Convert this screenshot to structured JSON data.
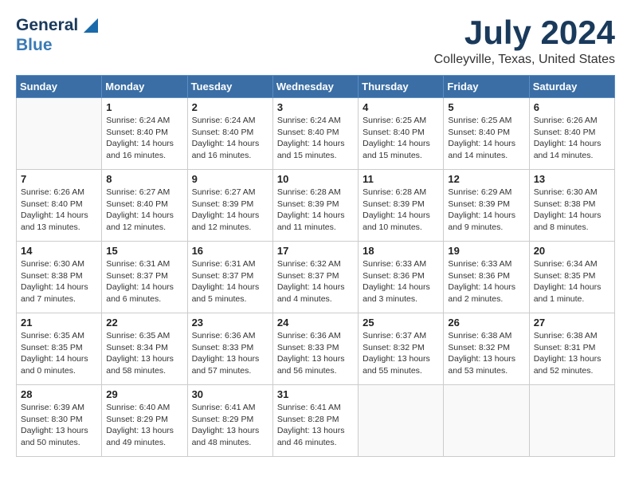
{
  "logo": {
    "line1": "General",
    "line2": "Blue"
  },
  "title": {
    "month_year": "July 2024",
    "location": "Colleyville, Texas, United States"
  },
  "weekdays": [
    "Sunday",
    "Monday",
    "Tuesday",
    "Wednesday",
    "Thursday",
    "Friday",
    "Saturday"
  ],
  "weeks": [
    [
      {
        "day": "",
        "info": ""
      },
      {
        "day": "1",
        "info": "Sunrise: 6:24 AM\nSunset: 8:40 PM\nDaylight: 14 hours\nand 16 minutes."
      },
      {
        "day": "2",
        "info": "Sunrise: 6:24 AM\nSunset: 8:40 PM\nDaylight: 14 hours\nand 16 minutes."
      },
      {
        "day": "3",
        "info": "Sunrise: 6:24 AM\nSunset: 8:40 PM\nDaylight: 14 hours\nand 15 minutes."
      },
      {
        "day": "4",
        "info": "Sunrise: 6:25 AM\nSunset: 8:40 PM\nDaylight: 14 hours\nand 15 minutes."
      },
      {
        "day": "5",
        "info": "Sunrise: 6:25 AM\nSunset: 8:40 PM\nDaylight: 14 hours\nand 14 minutes."
      },
      {
        "day": "6",
        "info": "Sunrise: 6:26 AM\nSunset: 8:40 PM\nDaylight: 14 hours\nand 14 minutes."
      }
    ],
    [
      {
        "day": "7",
        "info": "Sunrise: 6:26 AM\nSunset: 8:40 PM\nDaylight: 14 hours\nand 13 minutes."
      },
      {
        "day": "8",
        "info": "Sunrise: 6:27 AM\nSunset: 8:40 PM\nDaylight: 14 hours\nand 12 minutes."
      },
      {
        "day": "9",
        "info": "Sunrise: 6:27 AM\nSunset: 8:39 PM\nDaylight: 14 hours\nand 12 minutes."
      },
      {
        "day": "10",
        "info": "Sunrise: 6:28 AM\nSunset: 8:39 PM\nDaylight: 14 hours\nand 11 minutes."
      },
      {
        "day": "11",
        "info": "Sunrise: 6:28 AM\nSunset: 8:39 PM\nDaylight: 14 hours\nand 10 minutes."
      },
      {
        "day": "12",
        "info": "Sunrise: 6:29 AM\nSunset: 8:39 PM\nDaylight: 14 hours\nand 9 minutes."
      },
      {
        "day": "13",
        "info": "Sunrise: 6:30 AM\nSunset: 8:38 PM\nDaylight: 14 hours\nand 8 minutes."
      }
    ],
    [
      {
        "day": "14",
        "info": "Sunrise: 6:30 AM\nSunset: 8:38 PM\nDaylight: 14 hours\nand 7 minutes."
      },
      {
        "day": "15",
        "info": "Sunrise: 6:31 AM\nSunset: 8:37 PM\nDaylight: 14 hours\nand 6 minutes."
      },
      {
        "day": "16",
        "info": "Sunrise: 6:31 AM\nSunset: 8:37 PM\nDaylight: 14 hours\nand 5 minutes."
      },
      {
        "day": "17",
        "info": "Sunrise: 6:32 AM\nSunset: 8:37 PM\nDaylight: 14 hours\nand 4 minutes."
      },
      {
        "day": "18",
        "info": "Sunrise: 6:33 AM\nSunset: 8:36 PM\nDaylight: 14 hours\nand 3 minutes."
      },
      {
        "day": "19",
        "info": "Sunrise: 6:33 AM\nSunset: 8:36 PM\nDaylight: 14 hours\nand 2 minutes."
      },
      {
        "day": "20",
        "info": "Sunrise: 6:34 AM\nSunset: 8:35 PM\nDaylight: 14 hours\nand 1 minute."
      }
    ],
    [
      {
        "day": "21",
        "info": "Sunrise: 6:35 AM\nSunset: 8:35 PM\nDaylight: 14 hours\nand 0 minutes."
      },
      {
        "day": "22",
        "info": "Sunrise: 6:35 AM\nSunset: 8:34 PM\nDaylight: 13 hours\nand 58 minutes."
      },
      {
        "day": "23",
        "info": "Sunrise: 6:36 AM\nSunset: 8:33 PM\nDaylight: 13 hours\nand 57 minutes."
      },
      {
        "day": "24",
        "info": "Sunrise: 6:36 AM\nSunset: 8:33 PM\nDaylight: 13 hours\nand 56 minutes."
      },
      {
        "day": "25",
        "info": "Sunrise: 6:37 AM\nSunset: 8:32 PM\nDaylight: 13 hours\nand 55 minutes."
      },
      {
        "day": "26",
        "info": "Sunrise: 6:38 AM\nSunset: 8:32 PM\nDaylight: 13 hours\nand 53 minutes."
      },
      {
        "day": "27",
        "info": "Sunrise: 6:38 AM\nSunset: 8:31 PM\nDaylight: 13 hours\nand 52 minutes."
      }
    ],
    [
      {
        "day": "28",
        "info": "Sunrise: 6:39 AM\nSunset: 8:30 PM\nDaylight: 13 hours\nand 50 minutes."
      },
      {
        "day": "29",
        "info": "Sunrise: 6:40 AM\nSunset: 8:29 PM\nDaylight: 13 hours\nand 49 minutes."
      },
      {
        "day": "30",
        "info": "Sunrise: 6:41 AM\nSunset: 8:29 PM\nDaylight: 13 hours\nand 48 minutes."
      },
      {
        "day": "31",
        "info": "Sunrise: 6:41 AM\nSunset: 8:28 PM\nDaylight: 13 hours\nand 46 minutes."
      },
      {
        "day": "",
        "info": ""
      },
      {
        "day": "",
        "info": ""
      },
      {
        "day": "",
        "info": ""
      }
    ]
  ]
}
